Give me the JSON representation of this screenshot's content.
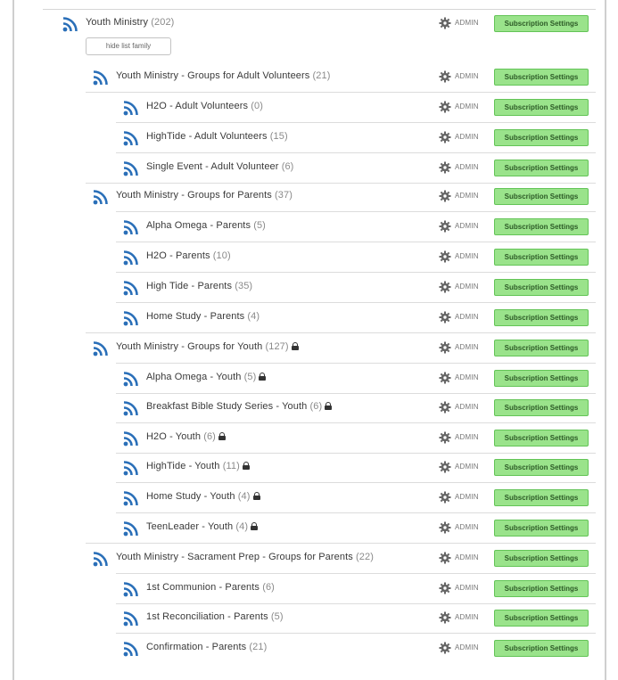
{
  "admin_label": "ADMIN",
  "subscription_label": "Subscription Settings",
  "hide_button_label": "hide list family",
  "colors": {
    "feed_icon": "#2a6fb8",
    "button_bg": "#9ae38b",
    "button_border": "#63c457"
  },
  "groups": [
    {
      "name": "Youth Ministry",
      "count": "(202)",
      "locked": false
    },
    {
      "name": "Youth Ministry - Groups for Adult Volunteers",
      "count": "(21)",
      "locked": false
    },
    {
      "name": "H2O - Adult Volunteers",
      "count": "(0)",
      "locked": false
    },
    {
      "name": "HighTide - Adult Volunteers",
      "count": "(15)",
      "locked": false
    },
    {
      "name": "Single Event - Adult Volunteer",
      "count": "(6)",
      "locked": false
    },
    {
      "name": "Youth Ministry - Groups for Parents",
      "count": "(37)",
      "locked": false
    },
    {
      "name": "Alpha Omega - Parents",
      "count": "(5)",
      "locked": false
    },
    {
      "name": "H2O - Parents",
      "count": "(10)",
      "locked": false
    },
    {
      "name": "High Tide - Parents",
      "count": "(35)",
      "locked": false
    },
    {
      "name": "Home Study - Parents",
      "count": "(4)",
      "locked": false
    },
    {
      "name": "Youth Ministry - Groups for Youth",
      "count": "(127)",
      "locked": true
    },
    {
      "name": "Alpha Omega - Youth",
      "count": "(5)",
      "locked": true
    },
    {
      "name": "Breakfast Bible Study Series - Youth",
      "count": "(6)",
      "locked": true
    },
    {
      "name": "H2O - Youth",
      "count": "(6)",
      "locked": true
    },
    {
      "name": "HighTide - Youth",
      "count": "(11)",
      "locked": true
    },
    {
      "name": "Home Study - Youth",
      "count": "(4)",
      "locked": true
    },
    {
      "name": "TeenLeader - Youth",
      "count": "(4)",
      "locked": true
    },
    {
      "name": "Youth Ministry - Sacrament Prep - Groups for Parents",
      "count": "(22)",
      "locked": false
    },
    {
      "name": "1st Communion - Parents",
      "count": "(6)",
      "locked": false
    },
    {
      "name": "1st Reconciliation - Parents",
      "count": "(5)",
      "locked": false
    },
    {
      "name": "Confirmation - Parents",
      "count": "(21)",
      "locked": false
    }
  ]
}
